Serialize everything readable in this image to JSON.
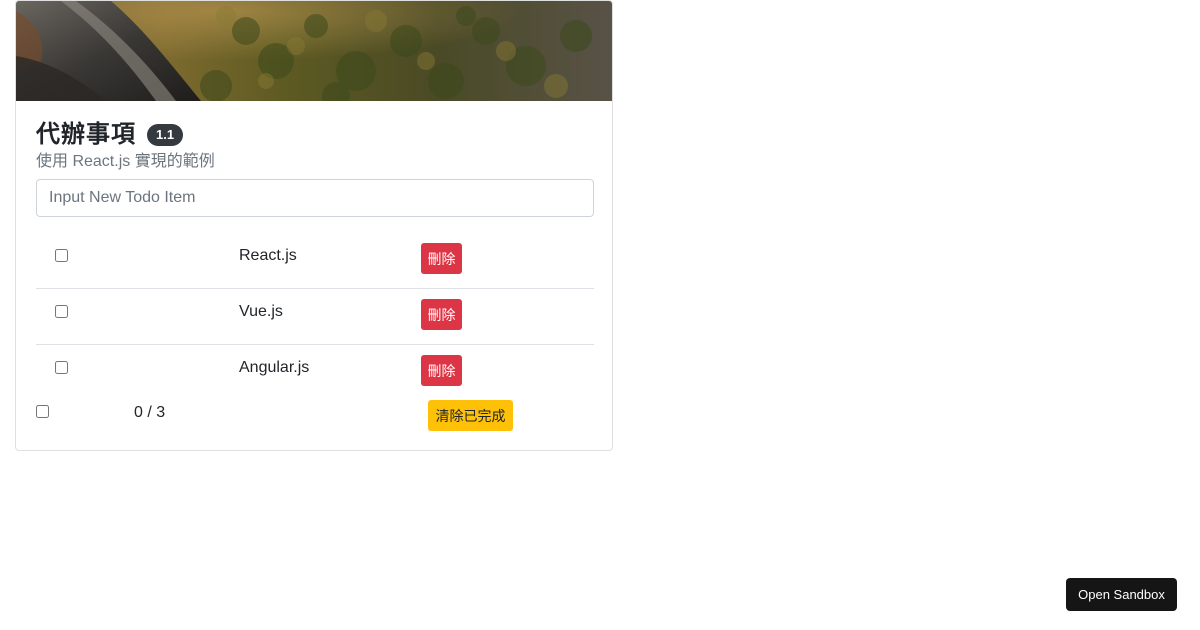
{
  "app": {
    "title": "代辦事項",
    "version": "1.1",
    "subtitle": "使用 React.js 實現的範例"
  },
  "input": {
    "placeholder": "Input New Todo Item",
    "value": ""
  },
  "todos": [
    {
      "text": "React.js",
      "done": false,
      "delete_label": "刪除"
    },
    {
      "text": "Vue.js",
      "done": false,
      "delete_label": "刪除"
    },
    {
      "text": "Angular.js",
      "done": false,
      "delete_label": "刪除"
    }
  ],
  "footer": {
    "all_checked": false,
    "count": "0 / 3",
    "clear_label": "清除已完成"
  },
  "sandbox": {
    "label": "Open Sandbox"
  },
  "colors": {
    "danger": "#dc3545",
    "warning": "#ffc107",
    "badge": "#343a40",
    "sandbox": "#151515"
  }
}
